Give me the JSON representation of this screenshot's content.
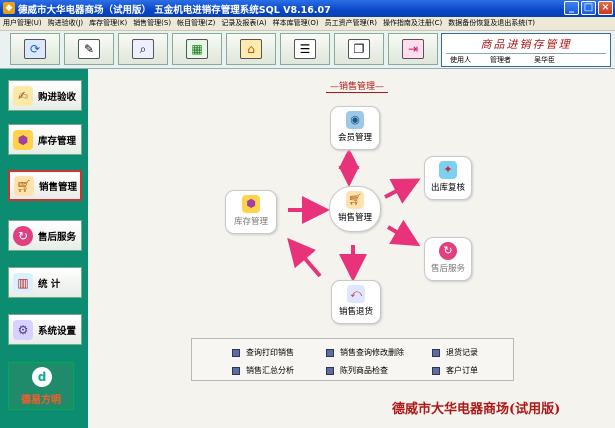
{
  "window": {
    "title": "德威市大华电器商场（试用版）  五金机电进销存管理系统SQL  V8.16.07",
    "btn_min": "_",
    "btn_max": "□",
    "btn_close": "×"
  },
  "menu": [
    "用户管理(U)",
    "购进验收(J)",
    "库存管理(K)",
    "销售管理(S)",
    "帐目管理(Z)",
    "记录及报表(A)",
    "样本库管理(O)",
    "员工资产管理(R)",
    "操作指南及注册(C)",
    "数据备份恢复及退出系统(T)"
  ],
  "toolbar_icons": [
    "refresh-icon",
    "edit-icon",
    "search-icon",
    "spreadsheet-icon",
    "house-icon",
    "list-icon",
    "copy-icon",
    "exit-icon"
  ],
  "brand_panel": {
    "title": "商品进销存管理",
    "user_label": "使用人",
    "role_label": "管理者",
    "user_name": "吴华臣"
  },
  "sidebar": {
    "items": [
      {
        "label": "购进验收",
        "icon": "purchase-icon"
      },
      {
        "label": "库存管理",
        "icon": "inventory-icon"
      },
      {
        "label": "销售管理",
        "icon": "cart-icon"
      },
      {
        "label": "售后服务",
        "icon": "service-icon"
      },
      {
        "label": "统  计",
        "icon": "chart-icon"
      },
      {
        "label": "系统设置",
        "icon": "settings-icon"
      }
    ],
    "logo_text": "德易方明",
    "logo_glyph": "d"
  },
  "flow": {
    "section_title": "—销售管理—",
    "center": "销售管理",
    "member": "会员管理",
    "outbound": "出库复核",
    "service": "售后服务",
    "returns": "销售退货",
    "inventory": "库存管理"
  },
  "links": [
    "查询打印销售",
    "销售查询修改删除",
    "退货记录",
    "销售汇总分析",
    "陈列商品检查",
    "客户订单"
  ],
  "footer_brand": "德威市大华电器商场(试用版)",
  "colors": {
    "titlebar": "#0a46c8",
    "sidebar": "#0c8d72",
    "accent_red": "#b01818",
    "arrow_pink": "#e8337a"
  }
}
